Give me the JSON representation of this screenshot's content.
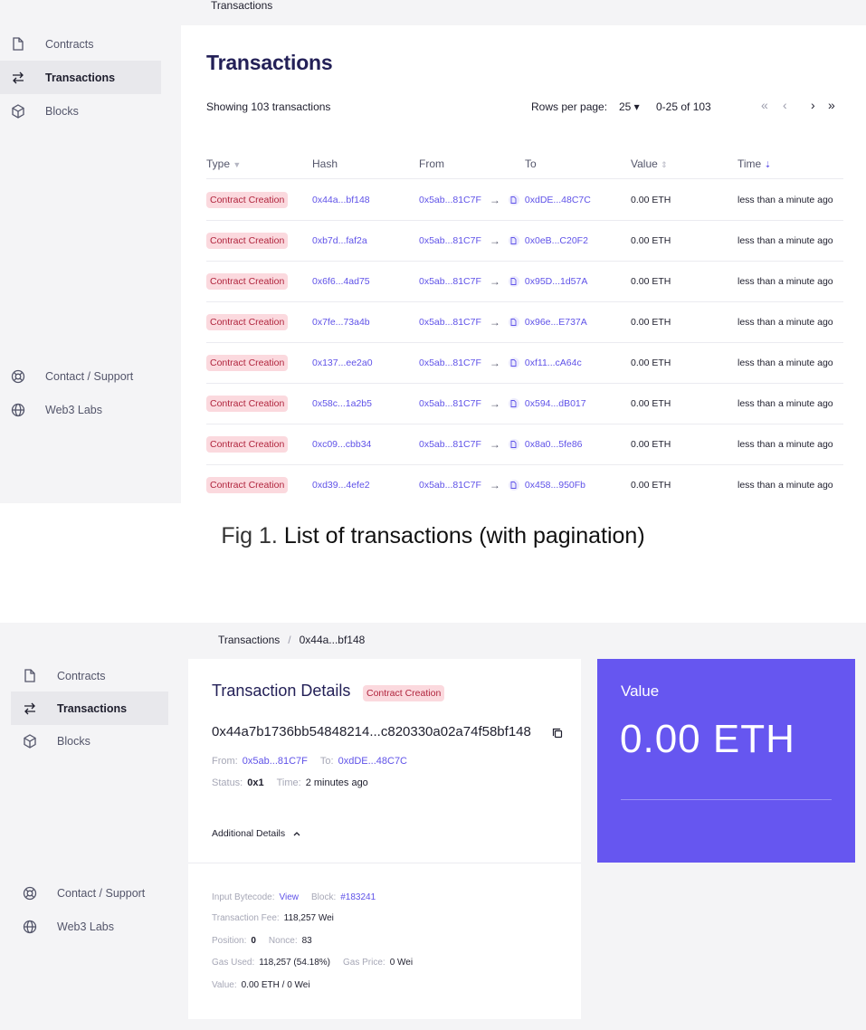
{
  "fig1": {
    "breadcrumb": "Transactions",
    "sidebar": {
      "items": [
        {
          "label": "Contracts",
          "icon": "file-icon"
        },
        {
          "label": "Transactions",
          "icon": "swap-arrows-icon",
          "active": true
        },
        {
          "label": "Blocks",
          "icon": "cube-icon"
        }
      ],
      "footer_items": [
        {
          "label": "Contact / Support",
          "icon": "lifebuoy-icon"
        },
        {
          "label": "Web3 Labs",
          "icon": "globe-icon"
        }
      ]
    },
    "title": "Transactions",
    "showing": "Showing 103 transactions",
    "pagination": {
      "rows_label": "Rows per page:",
      "rows_value": "25 ▾",
      "range": "0-25 of 103",
      "first": "«",
      "prev": "‹",
      "next": "›",
      "last": "»"
    },
    "columns": [
      "Type",
      "Hash",
      "From",
      "To",
      "Value",
      "Time"
    ],
    "rows": [
      {
        "type": "Contract Creation",
        "hash": "0x44a...bf148",
        "from": "0x5ab...81C7F",
        "to": "0xdDE...48C7C",
        "value": "0.00 ETH",
        "time": "less than a minute ago"
      },
      {
        "type": "Contract Creation",
        "hash": "0xb7d...faf2a",
        "from": "0x5ab...81C7F",
        "to": "0x0eB...C20F2",
        "value": "0.00 ETH",
        "time": "less than a minute ago"
      },
      {
        "type": "Contract Creation",
        "hash": "0x6f6...4ad75",
        "from": "0x5ab...81C7F",
        "to": "0x95D...1d57A",
        "value": "0.00 ETH",
        "time": "less than a minute ago"
      },
      {
        "type": "Contract Creation",
        "hash": "0x7fe...73a4b",
        "from": "0x5ab...81C7F",
        "to": "0x96e...E737A",
        "value": "0.00 ETH",
        "time": "less than a minute ago"
      },
      {
        "type": "Contract Creation",
        "hash": "0x137...ee2a0",
        "from": "0x5ab...81C7F",
        "to": "0xf11...cA64c",
        "value": "0.00 ETH",
        "time": "less than a minute ago"
      },
      {
        "type": "Contract Creation",
        "hash": "0x58c...1a2b5",
        "from": "0x5ab...81C7F",
        "to": "0x594...dB017",
        "value": "0.00 ETH",
        "time": "less than a minute ago"
      },
      {
        "type": "Contract Creation",
        "hash": "0xc09...cbb34",
        "from": "0x5ab...81C7F",
        "to": "0x8a0...5fe86",
        "value": "0.00 ETH",
        "time": "less than a minute ago"
      },
      {
        "type": "Contract Creation",
        "hash": "0xd39...4efe2",
        "from": "0x5ab...81C7F",
        "to": "0x458...950Fb",
        "value": "0.00 ETH",
        "time": "less than a minute ago"
      }
    ],
    "caption_prefix": "Fig 1.",
    "caption": "List of transactions (with pagination)"
  },
  "fig2": {
    "breadcrumb": {
      "parent": "Transactions",
      "sep": "/",
      "current": "0x44a...bf148"
    },
    "sidebar": {
      "items": [
        {
          "label": "Contracts",
          "icon": "file-icon"
        },
        {
          "label": "Transactions",
          "icon": "swap-arrows-icon",
          "active": true
        },
        {
          "label": "Blocks",
          "icon": "cube-icon"
        }
      ],
      "footer_items": [
        {
          "label": "Contact / Support",
          "icon": "lifebuoy-icon"
        },
        {
          "label": "Web3 Labs",
          "icon": "globe-icon"
        }
      ]
    },
    "details": {
      "title": "Transaction Details",
      "badge": "Contract Creation",
      "hash": "0x44a7b1736bb54848214...c820330a02a74f58bf148",
      "from_label": "From:",
      "from": "0x5ab...81C7F",
      "to_label": "To:",
      "to": "0xdDE...48C7C",
      "status_label": "Status:",
      "status": "0x1",
      "time_label": "Time:",
      "time": "2 minutes ago",
      "additional_label": "Additional Details",
      "input_label": "Input Bytecode:",
      "input_link": "View",
      "block_label": "Block:",
      "block": "#183241",
      "fee_label": "Transaction Fee:",
      "fee": "118,257 Wei",
      "position_label": "Position:",
      "position": "0",
      "nonce_label": "Nonce:",
      "nonce": "83",
      "gas_used_label": "Gas Used:",
      "gas_used": "118,257 (54.18%)",
      "gas_price_label": "Gas Price:",
      "gas_price": "0 Wei",
      "value_label": "Value:",
      "value": "0.00 ETH / 0 Wei"
    },
    "value_card": {
      "label": "Value",
      "amount": "0.00 ETH"
    }
  },
  "colors": {
    "accent": "#6656f0",
    "link": "#5f52e8",
    "badge_bg": "#fbd9de",
    "badge_text": "#b0243d",
    "title": "#232057"
  }
}
